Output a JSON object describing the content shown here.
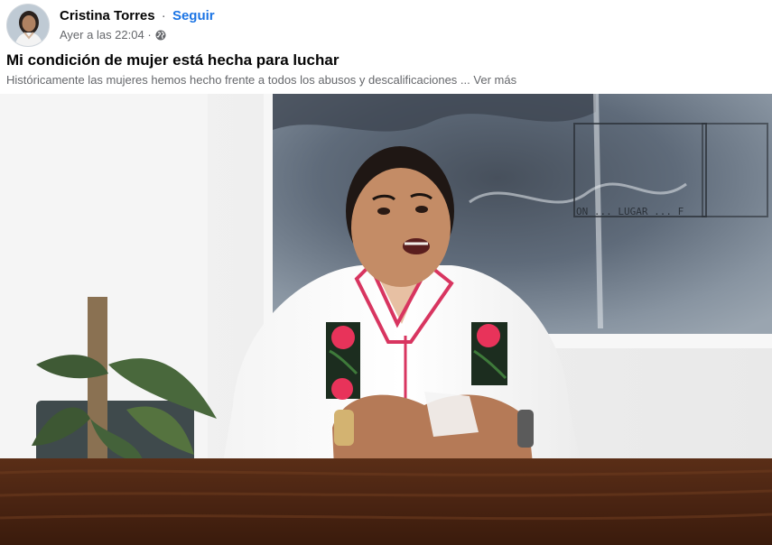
{
  "post": {
    "author": "Cristina Torres",
    "separator": "·",
    "follow_label": "Seguir",
    "timestamp": "Ayer a las 22:04 ·",
    "privacy_icon": "globe-icon",
    "title": "Mi condición de mujer está hecha para luchar",
    "excerpt": "Históricamente las mujeres hemos hecho frente a todos los abusos y descalificaciones ...",
    "see_more_label": "Ver más"
  },
  "video": {
    "painting_text": "ON ... LUGAR ... F"
  },
  "colors": {
    "link_blue": "#1b74e4",
    "meta_gray": "#65676b",
    "text_dark": "#050505"
  }
}
